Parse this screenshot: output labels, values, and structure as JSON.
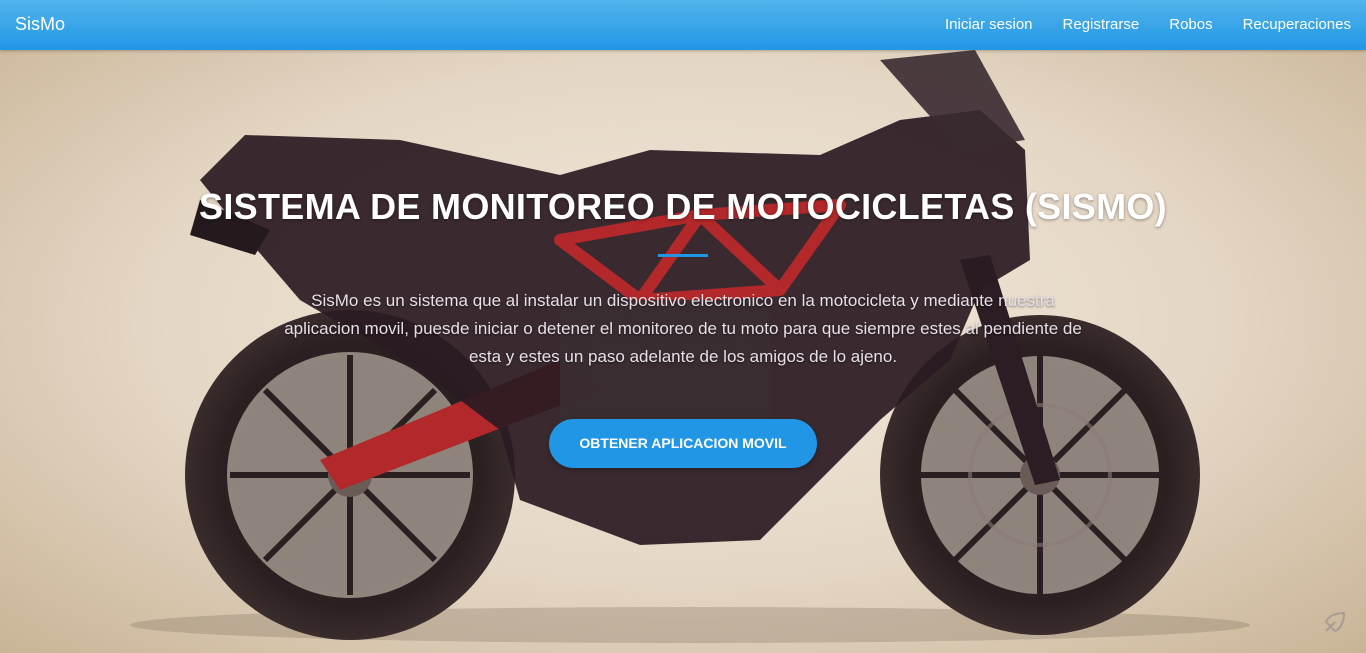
{
  "navbar": {
    "brand": "SisMo",
    "links": [
      {
        "label": "Iniciar sesion"
      },
      {
        "label": "Registrarse"
      },
      {
        "label": "Robos"
      },
      {
        "label": "Recuperaciones"
      }
    ]
  },
  "hero": {
    "title": "SISTEMA DE MONITOREO DE MOTOCICLETAS (SISMO)",
    "description": "SisMo es un sistema que al instalar un dispositivo electronico en la motocicleta y mediante nuestra aplicacion movil, puesde iniciar o detener el monitoreo de tu moto para que siempre estes al pendiente de esta y estes un paso adelante de los amigos de lo ajeno.",
    "cta_label": "OBTENER APLICACION MOVIL",
    "background_image": "motorcycle-photo",
    "corner_icon": "feather-icon"
  },
  "colors": {
    "accent": "#2196e4",
    "navbar_top": "#52b4ec",
    "frame_red": "#b3282a",
    "bike_body": "#2a1a22"
  }
}
